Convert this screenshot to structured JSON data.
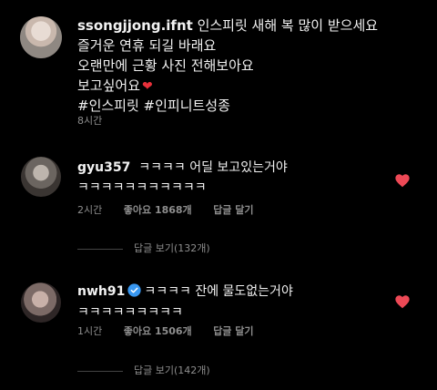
{
  "post": {
    "username": "ssongjjong.ifnt",
    "caption_lines": [
      "인스피릿 새해 복 많이 받으세요",
      "즐거운 연휴 되길 바래요",
      "오랜만에 근황 사진 전해보아요",
      "보고싶어요",
      "#인스피릿 #인피니트성종"
    ],
    "heart_emoji": "❤",
    "time": "8시간"
  },
  "comments": [
    {
      "username": "gyu357",
      "text_line1": "ㅋㅋㅋㅋ 어딜 보고있는거야",
      "text_line2": "ㅋㅋㅋㅋㅋㅋㅋㅋㅋㅋㅋ",
      "time": "2시간",
      "likes": "좋아요 1868개",
      "reply_label": "답글 달기",
      "view_replies": "답글 보기(132개)"
    },
    {
      "username": "nwh91",
      "verified": true,
      "text_line1": "ㅋㅋㅋㅋ 잔에 물도없는거야",
      "text_line2": "ㅋㅋㅋㅋㅋㅋㅋㅋㅋ",
      "time": "1시간",
      "likes": "좋아요 1506개",
      "reply_label": "답글 달기",
      "view_replies": "답글 보기(142개)"
    }
  ],
  "colors": {
    "background": "#000000",
    "text": "#f2f2f2",
    "muted": "#8e8e8e",
    "heart": "#ed4956",
    "verified": "#3897f0"
  }
}
